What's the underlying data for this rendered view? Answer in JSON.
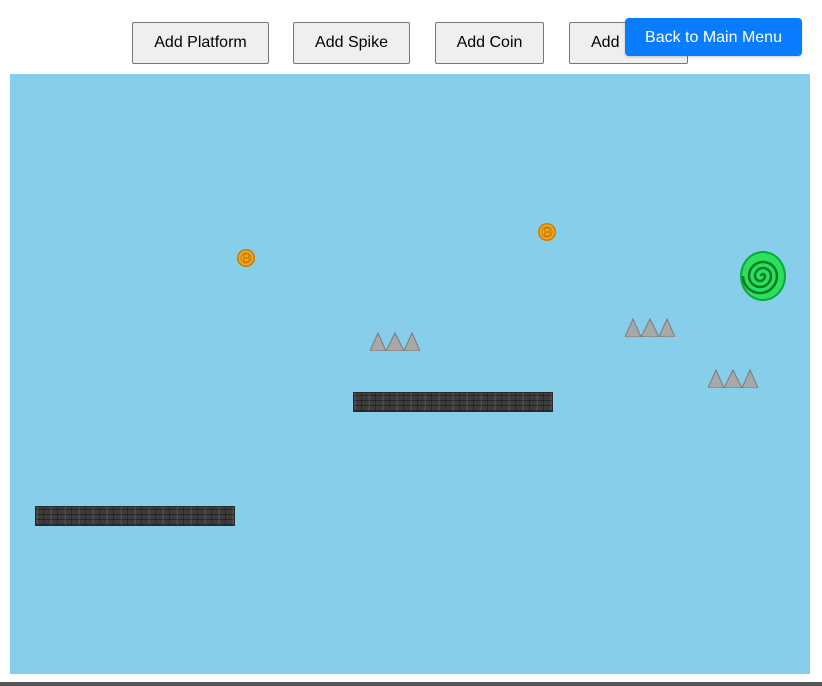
{
  "toolbar": {
    "add_platform_label": "Add Platform",
    "add_spike_label": "Add Spike",
    "add_coin_label": "Add Coin",
    "add_portal_label": "Add",
    "back_label": "Back to Main Menu"
  },
  "colors": {
    "sky": "#87ceeb",
    "back_button": "#0a7cff",
    "coin": "#f5a623",
    "portal": "#19c94a",
    "spike": "#a8a8a8",
    "platform": "#3c3c3c"
  },
  "level": {
    "platforms": 2,
    "spikes": 3,
    "coins": 2,
    "portals": 1
  }
}
